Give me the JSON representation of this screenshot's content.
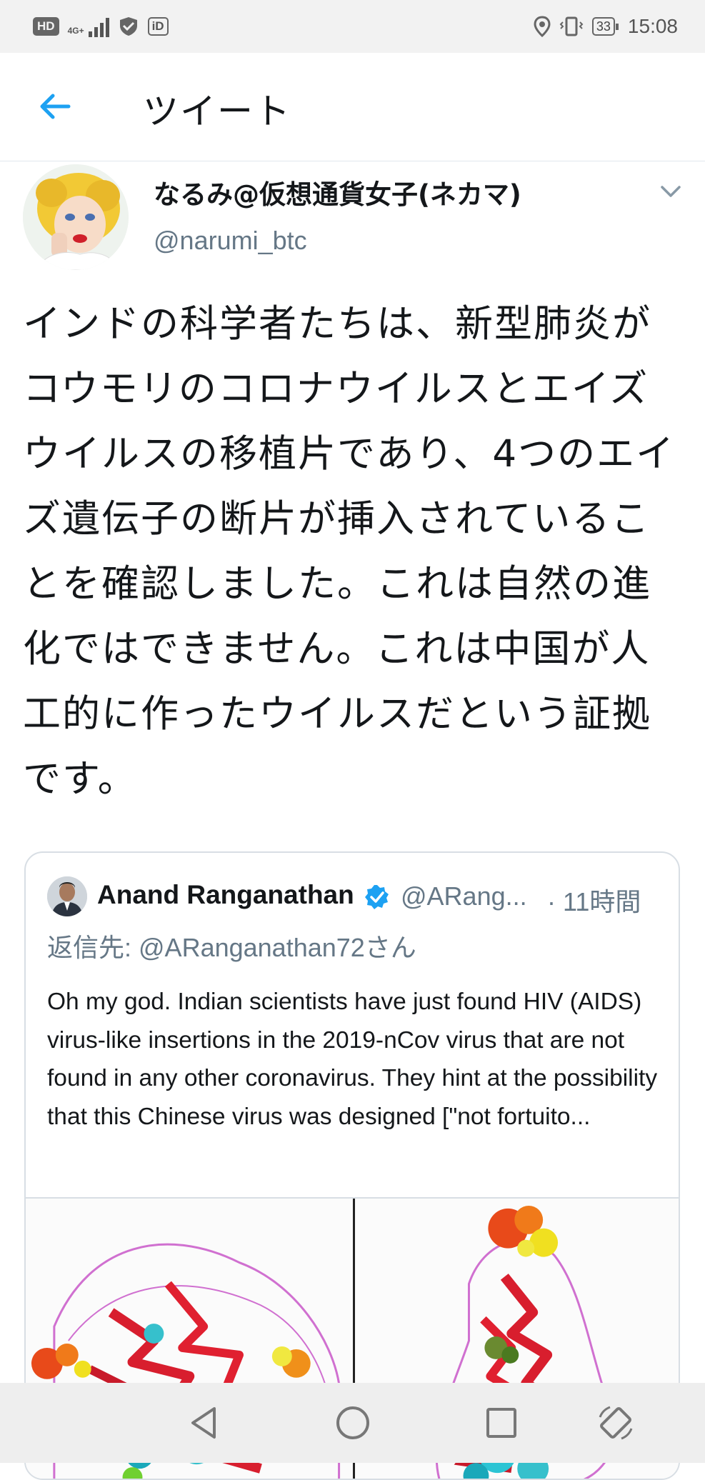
{
  "status_bar": {
    "hd": "HD",
    "network": "4G+",
    "id_icon": "iD",
    "battery": "33",
    "time": "15:08"
  },
  "header": {
    "title": "ツイート"
  },
  "tweet": {
    "display_name": "なるみ@仮想通貨女子(ネカマ)",
    "handle": "@narumi_btc",
    "text": "インドの科学者たちは、新型肺炎がコウモリのコロナウイルスとエイズウイルスの移植片であり、4つのエイズ遺伝子の断片が挿入されていることを確認しました。これは自然の進化ではできません。これは中国が人工的に作ったウイルスだという証拠です。"
  },
  "quoted_tweet": {
    "author_name": "Anand Ranganathan",
    "author_handle": "@ARang...",
    "time": "· 11時間",
    "reply_prefix": "返信先: ",
    "reply_to": "@ARanganathan72さん",
    "text": "Oh my god. Indian scientists have just found HIV (AIDS) virus-like insertions in the 2019-nCov virus that are not found in any other coronavirus. They hint at the possibility that this Chinese virus was designed [\"not fortuito..."
  },
  "colors": {
    "accent": "#1da1f2",
    "secondary_text": "#657786",
    "border": "#e1e8ed"
  },
  "icons": {
    "back": "arrow-left-icon",
    "caret": "chevron-down-icon",
    "verified": "verified-badge-icon",
    "nav_back": "triangle-back-icon",
    "nav_home": "circle-home-icon",
    "nav_recents": "square-recents-icon",
    "nav_rotate": "rotate-icon"
  }
}
